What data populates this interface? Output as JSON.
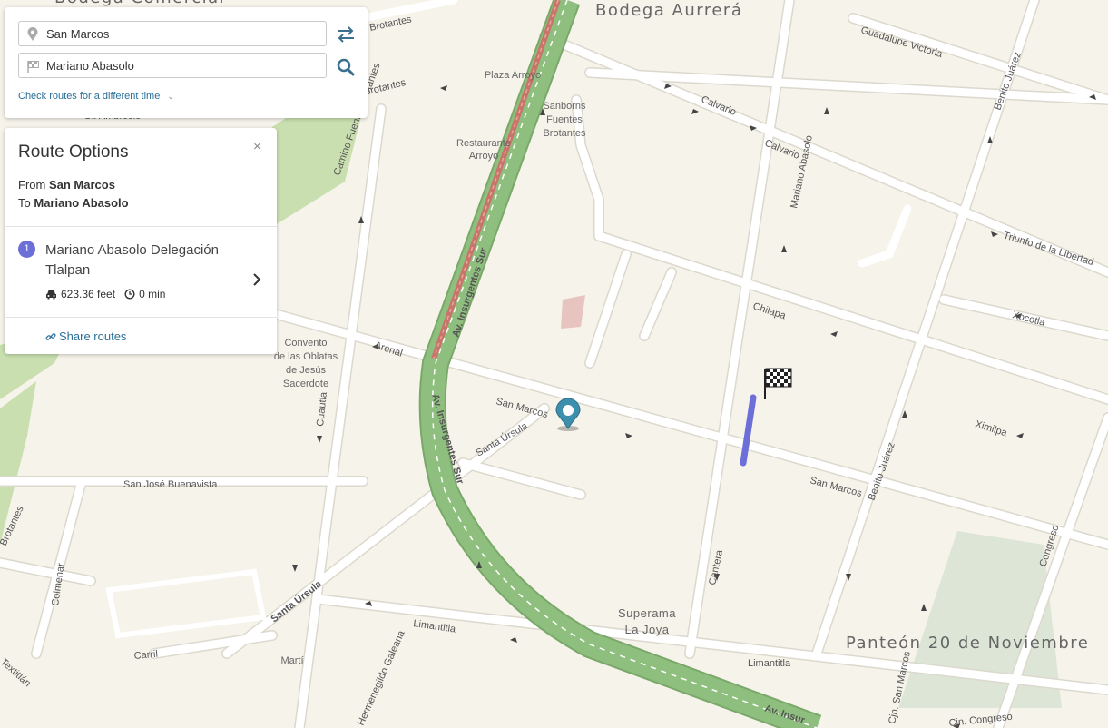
{
  "search": {
    "from_value": "San Marcos",
    "to_value": "Mariano Abasolo",
    "time_link": "Check routes for a different time",
    "swap_icon": "swap-arrows-icon",
    "search_icon": "search-icon"
  },
  "route_options": {
    "title": "Route Options",
    "close_symbol": "×",
    "from_prefix": "From",
    "from_place": "San Marcos",
    "to_prefix": "To",
    "to_place": "Mariano Abasolo",
    "routes": [
      {
        "number": "1",
        "name": "Mariano Abasolo Delegación Tlalpan",
        "distance": "623.36 feet",
        "time": "0 min"
      }
    ],
    "share_label": "Share routes"
  },
  "map": {
    "pois": {
      "bodega_aurrera": "Bodega Aurrerá",
      "bodega_comercial": "Bodega Comercial",
      "panteon": "Panteón 20 de Noviembre",
      "superama_line1": "Superama",
      "superama_line2": "La Joya",
      "plaza_arroyo": "Plaza Arroyo",
      "restaurante_line1": "Restaurante",
      "restaurante_line2": "Arroyo",
      "sanborns_line1": "Sanborns",
      "sanborns_line2": "Fuentes",
      "sanborns_line3": "Brotantes",
      "convento_line1": "Convento",
      "convento_line2": "de las Oblatas",
      "convento_line3": "de Jesús",
      "convento_line4": "Sacerdote",
      "marti": "Martí",
      "st_ambrosio": "St. Ambrosio"
    },
    "streets": {
      "insurgentes": "Av. Insurgentes Sur",
      "insurgentes_short": "Av. Insur",
      "calvario": "Calvario",
      "guadalupe_victoria": "Guadalupe Victoria",
      "benito_juarez": "Benito Juárez",
      "triunfo": "Triunfo de la Libertad",
      "mariano_abasolo": "Mariano Abasolo",
      "chilapa": "Chilapa",
      "xocotla": "Xocotla",
      "ximilpa": "Ximilpa",
      "san_marcos": "San Marcos",
      "santa_ursula": "Santa Úrsula",
      "arenal": "Arenal",
      "cuautla": "Cuautla",
      "san_jose": "San José Buenavista",
      "camino_fuentes": "Camino Fuentes Brotantes",
      "brotantes": "Brotantes",
      "colmenar": "Colmenar",
      "carril": "Carril",
      "limantitla": "Limantitla",
      "cantera": "Cantera",
      "congreso": "Congreso",
      "cjn_san_marcos": "Cjn. San Marcos",
      "cjn_congreso": "Cjn. Congreso",
      "hermenegildo": "Hermenegildo Galeana",
      "textitlan": "Textitlán"
    },
    "colors": {
      "background": "#f6f3ea",
      "road": "#ffffff",
      "road_casing": "#dcd8cd",
      "highway": "#8fbf7e",
      "traffic": "#c9746a",
      "route": "#6d6fd8",
      "park": "#c9dfaf",
      "cemetery": "#dde5d6",
      "marker": "#3d8fae"
    }
  }
}
